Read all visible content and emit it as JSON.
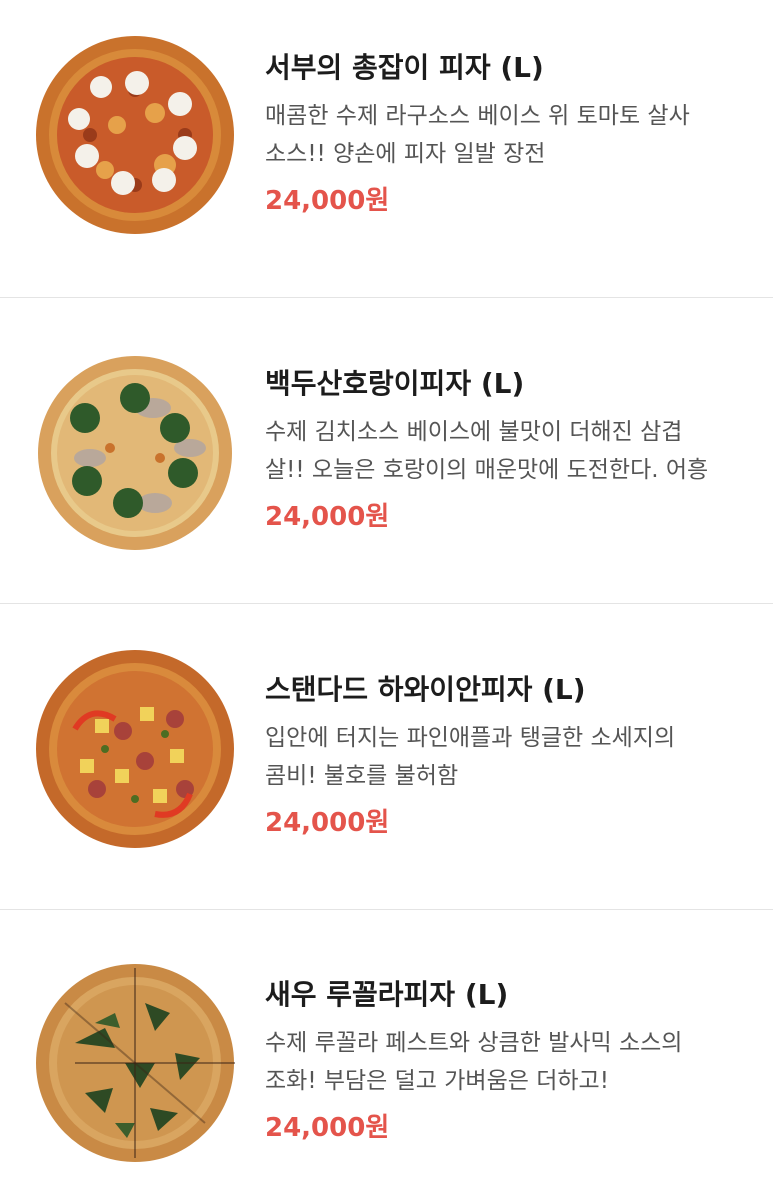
{
  "colors": {
    "price": "#e4544b",
    "name": "#1c1c1c",
    "description": "#555555",
    "divider": "#e4e4e4"
  },
  "menu": {
    "items": [
      {
        "name": "서부의 총잡이 피자 (L)",
        "desc_line1": "매콤한 수제 라구소스 베이스 위 토마토 살사",
        "desc_line2": "소스!! 양손에 피자 일발 장전",
        "price": "24,000원",
        "image": "pizza-western-gunslinger-image"
      },
      {
        "name": "백두산호랑이피자 (L)",
        "desc_line1": "수제 김치소스 베이스에 불맛이 더해진 삼겹",
        "desc_line2": "살!! 오늘은 호랑이의 매운맛에 도전한다. 어흥",
        "price": "24,000원",
        "image": "pizza-baekdu-tiger-image"
      },
      {
        "name": "스탠다드 하와이안피자 (L)",
        "desc_line1": "입안에 터지는 파인애플과 탱글한 소세지의",
        "desc_line2": "콤비! 불호를 불허함",
        "price": "24,000원",
        "image": "pizza-standard-hawaiian-image"
      },
      {
        "name": "새우 루꼴라피자 (L)",
        "desc_line1": "수제 루꼴라 페스트와 상큼한 발사믹 소스의",
        "desc_line2": "조화! 부담은 덜고 가벼움은 더하고!",
        "price": "24,000원",
        "image": "pizza-shrimp-arugula-image"
      }
    ]
  }
}
